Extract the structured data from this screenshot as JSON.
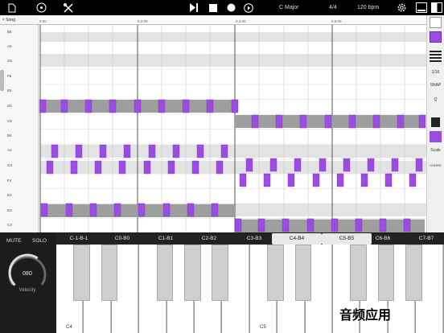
{
  "toolbar": {
    "key": "C Major",
    "time_signature": "4/4",
    "tempo": "120 bpm",
    "icons": [
      "document-icon",
      "record-disc-icon",
      "tools-icon",
      "skip-to-end-icon",
      "stop-icon",
      "record-icon",
      "play-icon",
      "gear-icon",
      "window-icon",
      "split-view-icon"
    ]
  },
  "song_button": "< Song",
  "note_labels": [
    "B5",
    "A5",
    "G5",
    "F5",
    "E5",
    "D5",
    "C5",
    "B4",
    "A4",
    "G4",
    "F4",
    "E4",
    "D4",
    "C4"
  ],
  "ruler_labels": [
    "0.00",
    "0.2.00",
    "0.4.00",
    "0.6.00"
  ],
  "right_panel": {
    "quantize_value": "1/16",
    "snap_label": "SNAP",
    "q_label": "Q",
    "scale_label": "Scale",
    "chord_label": "CHORD"
  },
  "mute_label": "MUTE",
  "solo_label": "SOLO",
  "velocity": {
    "value": "080",
    "label": "Velocity",
    "level": 0.63
  },
  "octaves": [
    {
      "label": "C-1-B-1",
      "selected": false
    },
    {
      "label": "C0-B0",
      "selected": false
    },
    {
      "label": "C1-B1",
      "selected": false
    },
    {
      "label": "C2-B2",
      "selected": false
    },
    {
      "label": "C3-B3",
      "selected": false
    },
    {
      "label": "C4-B4",
      "selected": true
    },
    {
      "label": "C5-B5",
      "selected": true
    },
    {
      "label": "C6-B6",
      "selected": false
    },
    {
      "label": "C7-B7",
      "selected": false
    }
  ],
  "piano_labels": {
    "c4": "C4",
    "c5": "C5"
  },
  "stamp_text": "音频应用",
  "colors": {
    "note": "#9a4de0",
    "bar": "#9e9e9e",
    "grid_shade": "#e3e3e3"
  }
}
